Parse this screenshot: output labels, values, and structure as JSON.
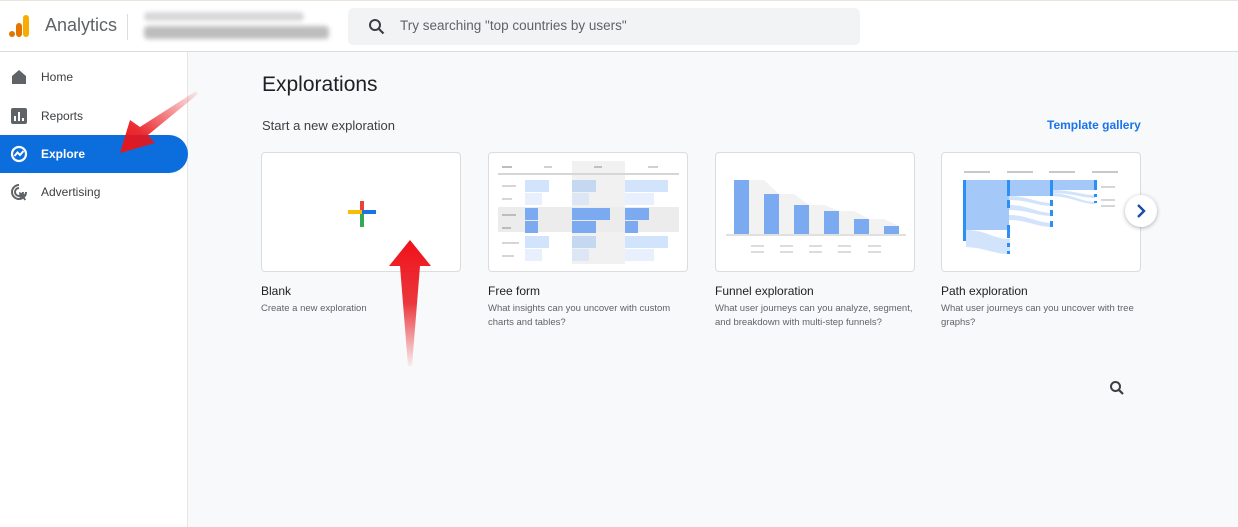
{
  "header": {
    "app_name": "Analytics",
    "account_selector": "(blurred account name)",
    "search_placeholder": "Try searching \"top countries by users\""
  },
  "sidebar": {
    "items": [
      {
        "label": "Home",
        "icon": "home-icon",
        "active": false
      },
      {
        "label": "Reports",
        "icon": "reports-icon",
        "active": false
      },
      {
        "label": "Explore",
        "icon": "explore-icon",
        "active": true
      },
      {
        "label": "Advertising",
        "icon": "advertising-icon",
        "active": false
      }
    ]
  },
  "main": {
    "title": "Explorations",
    "subtitle": "Start a new exploration",
    "template_gallery_label": "Template gallery",
    "templates": [
      {
        "title": "Blank",
        "description": "Create a new exploration",
        "thumbnail": "plus-icon"
      },
      {
        "title": "Free form",
        "description": "What insights can you uncover with custom charts and tables?",
        "thumbnail": "table-thumbnail"
      },
      {
        "title": "Funnel exploration",
        "description": "What user journeys can you analyze, segment, and breakdown with multi-step funnels?",
        "thumbnail": "funnel-thumbnail"
      },
      {
        "title": "Path exploration",
        "description": "What user journeys can you uncover with tree graphs?",
        "thumbnail": "path-thumbnail"
      }
    ],
    "next_button_icon": "chevron-right-icon",
    "bottom_search_icon": "search-icon"
  },
  "colors": {
    "accent": "#0b6edc",
    "link": "#1a73e8",
    "annotation_arrow": "#e8151b"
  },
  "annotations": [
    {
      "type": "arrow",
      "points_to": "Explore"
    },
    {
      "type": "arrow",
      "points_to": "Blank"
    }
  ]
}
